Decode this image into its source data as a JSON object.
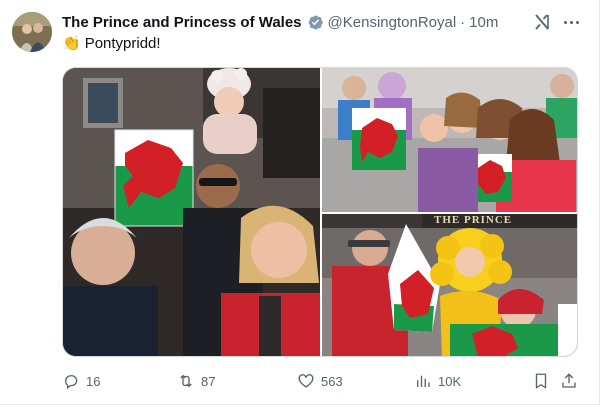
{
  "tweet": {
    "display_name": "The Prince and Princess of Wales",
    "handle": "@KensingtonRoyal",
    "separator": "·",
    "time": "10m",
    "emoji": "👏",
    "text": "Pontypridd!",
    "verified_color": "#829aab"
  },
  "media": {
    "photos": [
      {
        "name": "crowd-with-baby-and-welsh-flag"
      },
      {
        "name": "children-waving-welsh-flags"
      },
      {
        "name": "child-in-daffodil-costume-with-flag"
      }
    ],
    "storefront_sign": "THE PRINCE"
  },
  "actions": {
    "replies": "16",
    "reposts": "87",
    "likes": "563",
    "views": "10K"
  },
  "icons": {
    "reply": "reply-icon",
    "repost": "repost-icon",
    "like": "heart-icon",
    "views": "views-icon",
    "bookmark": "bookmark-icon",
    "share": "share-icon",
    "more": "more-icon",
    "grok": "grok-icon"
  },
  "colors": {
    "text": "#0f1419",
    "muted": "#536471",
    "flag_red": "#d32027",
    "flag_green": "#1a9a48"
  }
}
